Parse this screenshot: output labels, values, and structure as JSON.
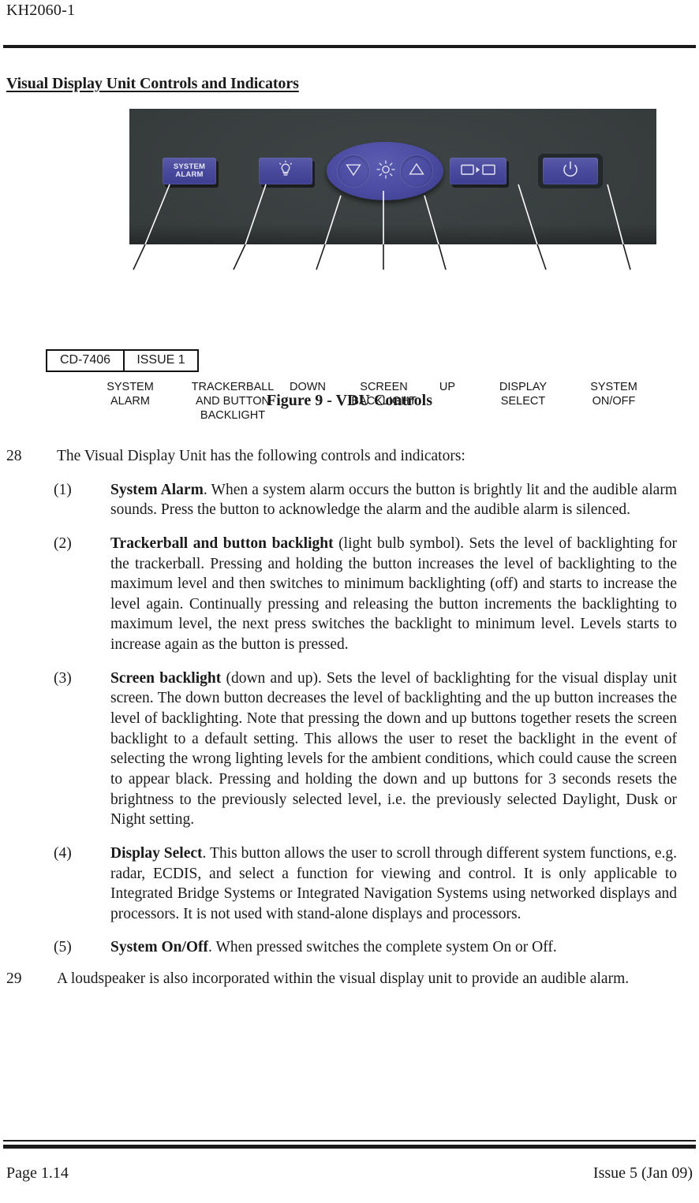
{
  "header": {
    "doc_ref": "KH2060-1",
    "section_title": "Visual Display Unit Controls and Indicators"
  },
  "figure": {
    "caption": "Figure 9 - VDU Controls",
    "drawing_box": {
      "drawing_number": "CD-7406",
      "issue": "ISSUE 1"
    },
    "panel_buttons": [
      {
        "name": "system-alarm-button",
        "label_line1": "SYSTEM",
        "label_line2": "ALARM",
        "icon": "text-label"
      },
      {
        "name": "trackerball-backlight-button",
        "label": "",
        "icon": "light-bulb-icon"
      },
      {
        "name": "screen-backlight-down-button",
        "label": "",
        "icon": "down-triangle-icon"
      },
      {
        "name": "screen-backlight-indicator",
        "label": "",
        "icon": "sun-brightness-icon"
      },
      {
        "name": "screen-backlight-up-button",
        "label": "",
        "icon": "up-triangle-icon"
      },
      {
        "name": "display-select-button",
        "label": "",
        "icon": "display-select-icon"
      },
      {
        "name": "system-on-off-button",
        "label": "",
        "icon": "power-icon"
      }
    ],
    "callouts": [
      {
        "text": "SYSTEM\nALARM"
      },
      {
        "text": "TRACKERBALL\nAND BUTTON\nBACKLIGHT"
      },
      {
        "text": "DOWN"
      },
      {
        "text": "SCREEN\nBACKLIGHT"
      },
      {
        "text": "UP"
      },
      {
        "text": "DISPLAY\nSELECT"
      },
      {
        "text": "SYSTEM\nON/OFF"
      }
    ]
  },
  "body": {
    "para28": {
      "number": "28",
      "text": "The Visual Display Unit has the following controls and indicators:"
    },
    "items": [
      {
        "number": "(1)",
        "bold": "System Alarm",
        "text": ". When a system alarm occurs the button is brightly lit and the audible alarm sounds. Press the button to acknowledge the alarm and the audible alarm is silenced."
      },
      {
        "number": "(2)",
        "bold": "Trackerball and button backlight",
        "text": "  (light bulb symbol). Sets the level of backlighting for the trackerball. Pressing and holding the button increases the level of backlighting to the maximum level and then switches to minimum backlighting (off) and starts to increase the level again. Continually pressing and releasing the button increments the backlighting to maximum level, the next press switches the backlight to minimum level. Levels starts to increase again as the button is pressed."
      },
      {
        "number": "(3)",
        "bold": "Screen backlight",
        "text": " (down and up). Sets the level of backlighting for the visual display unit screen. The down button decreases the level of backlighting and the up button increases the level of backlighting. Note that pressing the down and up buttons together resets the screen backlight to a default setting. This allows the user to reset the backlight in the event of selecting the wrong lighting levels for the ambient conditions, which could cause the screen to appear black. Pressing and holding the down and up buttons for 3 seconds resets the brightness to the previously selected level, i.e. the previously selected Daylight, Dusk or Night setting."
      },
      {
        "number": "(4)",
        "bold": "Display Select",
        "text": ". This button allows the user to scroll through different system functions, e.g. radar, ECDIS, and select a function for viewing and control. It is only applicable to Integrated Bridge Systems or Integrated Navigation Systems using networked displays and processors. It is not used with stand-alone displays and processors."
      },
      {
        "number": "(5)",
        "bold": "System On/Off",
        "text": ". When pressed switches the complete system On or Off."
      }
    ],
    "para29": {
      "number": "29",
      "text": "A loudspeaker is also incorporated within the visual display unit to provide an audible alarm."
    }
  },
  "footer": {
    "page": "Page 1.14",
    "issue": "Issue 5 (Jan 09)"
  },
  "colors": {
    "ink": "#1a1a1a",
    "panel_dark": "#373c3d",
    "button_blue": "#4a4a9e",
    "paper": "#ffffff"
  }
}
